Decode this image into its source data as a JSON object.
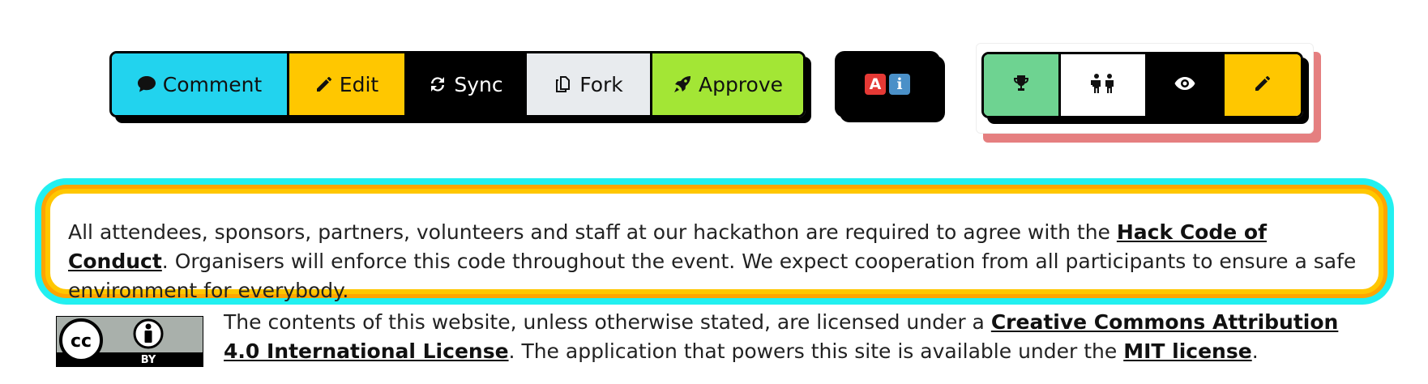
{
  "toolbar": {
    "comment_label": "Comment",
    "edit_label": "Edit",
    "sync_label": "Sync",
    "fork_label": "Fork",
    "approve_label": "Approve"
  },
  "ai_badge": {
    "letter_a": "A",
    "letter_i": "i"
  },
  "icon_toolbar": {
    "icons": [
      "trophy-icon",
      "people-icon",
      "eye-icon",
      "pencil-icon"
    ]
  },
  "conduct": {
    "text_before": "All attendees, sponsors, partners, volunteers and staff at our hackathon are required to agree with the ",
    "link_label": "Hack Code of Conduct",
    "text_after": ". Organisers will enforce this code throughout the event. We expect cooperation from all participants to ensure a safe environment for everybody."
  },
  "license": {
    "badge_cc": "cc",
    "badge_by": "BY",
    "text_before": "The contents of this website, unless otherwise stated, are licensed under a ",
    "cc_link_label": "Creative Commons Attribution 4.0 International License",
    "text_middle": ". The application that powers this site is available under the ",
    "mit_link_label": "MIT license",
    "text_after": "."
  },
  "colors": {
    "comment": "#22d3ee",
    "edit": "#ffc700",
    "sync": "#000000",
    "fork": "#e8ebee",
    "approve": "#a3e635",
    "trophy": "#6ed391",
    "panel_border_inner": "#ffc700",
    "panel_border_outer": "#22f0f0",
    "shadow_accent": "#e57f80"
  }
}
